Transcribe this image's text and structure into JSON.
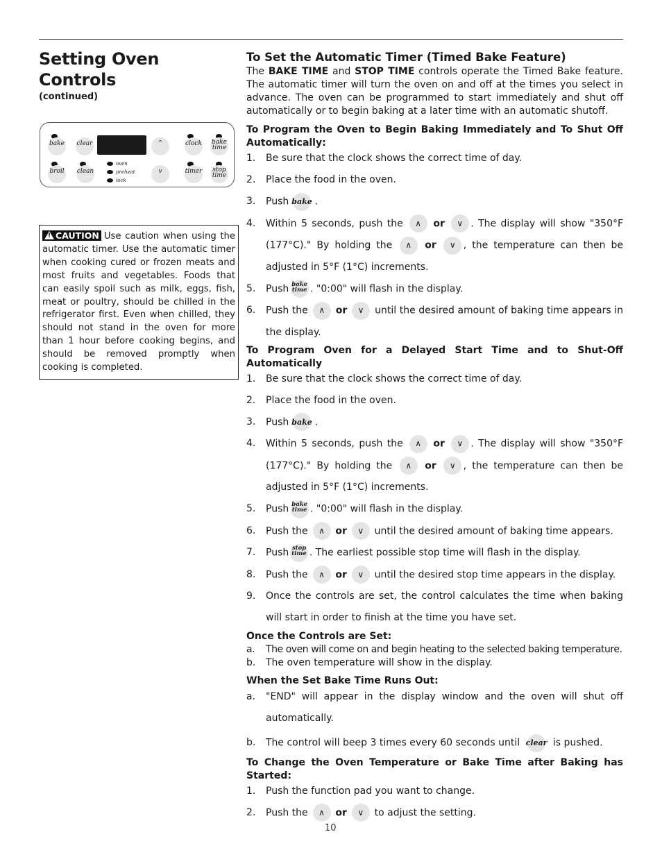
{
  "header": {
    "title": "Setting Oven Controls",
    "subtitle": "(continued)"
  },
  "control_panel": {
    "pads": {
      "bake": "bake",
      "clear": "clear",
      "broil": "broil",
      "clean": "clean",
      "clock": "clock",
      "timer": "timer",
      "bake_time_1": "bake",
      "bake_time_2": "time",
      "stop_time_1": "stop",
      "stop_time_2": "time",
      "up": "^",
      "down": "v"
    },
    "indicators": [
      "oven",
      "preheat",
      "lock"
    ]
  },
  "caution": {
    "badge": "CAUTION",
    "text": "Use caution when using the automatic timer. Use the automatic timer when cooking cured or frozen meats and most fruits and vegetables. Foods that can easily spoil such as milk, eggs, fish, meat or poultry, should be chilled in the refrigerator first. Even when chilled, they should not stand in the oven for more than 1 hour before cooking begins, and should be removed promptly when cooking is completed."
  },
  "main": {
    "title": "To Set the Automatic Timer (Timed Bake Feature)",
    "intro_1": "The ",
    "intro_bake": "BAKE TIME",
    "intro_2": " and ",
    "intro_stop": "STOP TIME",
    "intro_3": " controls operate the Timed Bake feature. The automatic timer will turn the oven on and off at the times you select in advance. The oven can be programmed to start immediately and shut off automatically or to begin baking at a later time with an automatic shutoff.",
    "sec1": {
      "heading": "To Program the Oven to Begin Baking Immediately and To Shut Off Automatically:",
      "s1": "Be sure that the clock shows the correct time of day.",
      "s2": "Place the food in the oven.",
      "s3a": "Push",
      "s3b": ".",
      "s4a": "Within 5 seconds, push the",
      "or": "or",
      "s4b": ". The display will show \"350°F (177°C).\" By holding the",
      "s4c": ", the temperature can then be adjusted in 5°F (1°C) increments.",
      "s5a": "Push",
      "s5b": ". \"0:00\" will flash in the display.",
      "s6a": "Push the",
      "s6b": "until the desired amount of baking time appears in the display."
    },
    "sec2": {
      "heading": "To Program Oven for a Delayed Start Time and to Shut-Off Automatically",
      "s6b": "until the desired amount of baking time appears.",
      "s7a": "Push",
      "s7b": ". The earliest possible stop time will flash in the display.",
      "s8a": "Push the",
      "s8b": "until the desired stop time appears in the display.",
      "s9": "Once the controls are set, the control calculates the time when baking will start in order to finish at the time you have set."
    },
    "sec3": {
      "heading": "Once the Controls are Set:",
      "a": "The oven will come on and begin heating to the selected baking temperature.",
      "b": "The oven temperature will show in the display."
    },
    "sec4": {
      "heading": "When the Set Bake Time Runs Out:",
      "a": "\"END\" will appear in the display window and the oven will shut off automatically.",
      "b1": "The control will beep 3 times every 60 seconds until",
      "b2": "is pushed."
    },
    "sec5": {
      "heading": "To Change the Oven Temperature or Bake Time after Baking has Started:",
      "s1": "Push the function pad you want to change.",
      "s2a": "Push the",
      "s2b": "to adjust the setting."
    },
    "nums": [
      "1.",
      "2.",
      "3.",
      "4.",
      "5.",
      "6.",
      "7.",
      "8.",
      "9."
    ],
    "letters": [
      "a.",
      "b."
    ]
  },
  "footer": {
    "page_number": "10"
  }
}
